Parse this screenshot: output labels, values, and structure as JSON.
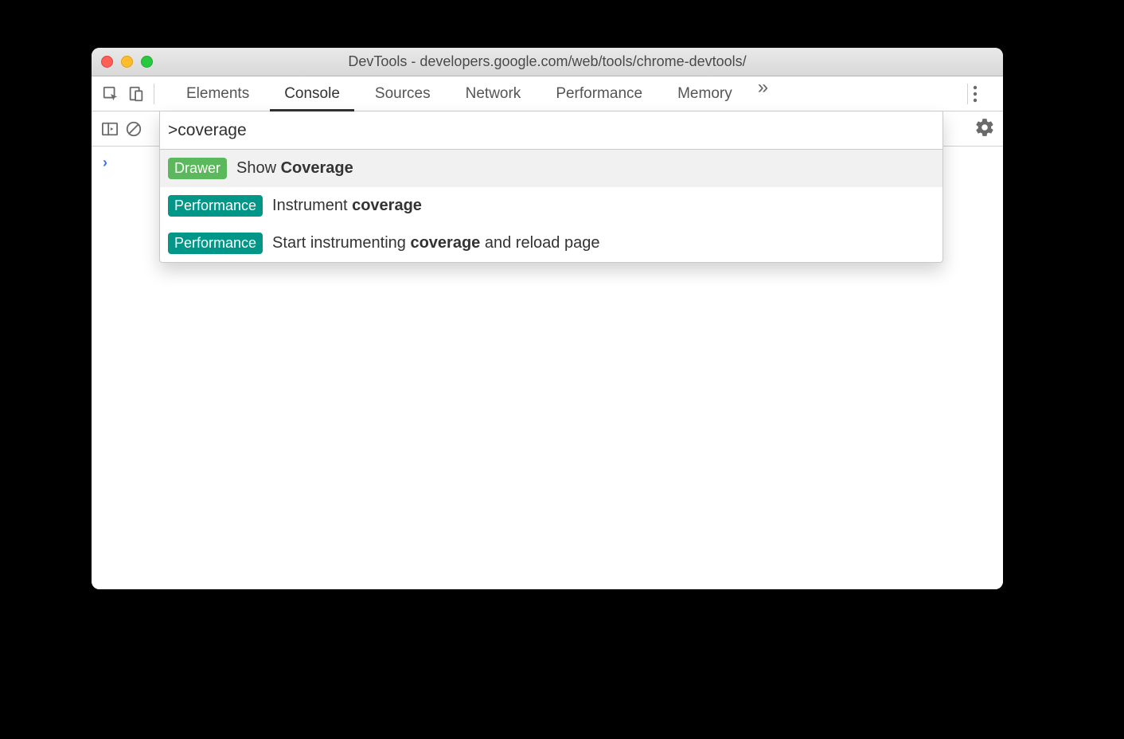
{
  "window": {
    "title": "DevTools - developers.google.com/web/tools/chrome-devtools/"
  },
  "tabs": {
    "items": [
      "Elements",
      "Console",
      "Sources",
      "Network",
      "Performance",
      "Memory"
    ],
    "active": "Console",
    "overflow_glyph": "»"
  },
  "command_menu": {
    "input_value": ">coverage",
    "items": [
      {
        "badge": "Drawer",
        "badge_class": "drawer",
        "prefix": "Show ",
        "match": "Coverage",
        "suffix": "",
        "selected": true
      },
      {
        "badge": "Performance",
        "badge_class": "performance",
        "prefix": "Instrument ",
        "match": "coverage",
        "suffix": "",
        "selected": false
      },
      {
        "badge": "Performance",
        "badge_class": "performance",
        "prefix": "Start instrumenting ",
        "match": "coverage",
        "suffix": " and reload page",
        "selected": false
      }
    ]
  },
  "console": {
    "prompt_glyph": "›"
  }
}
